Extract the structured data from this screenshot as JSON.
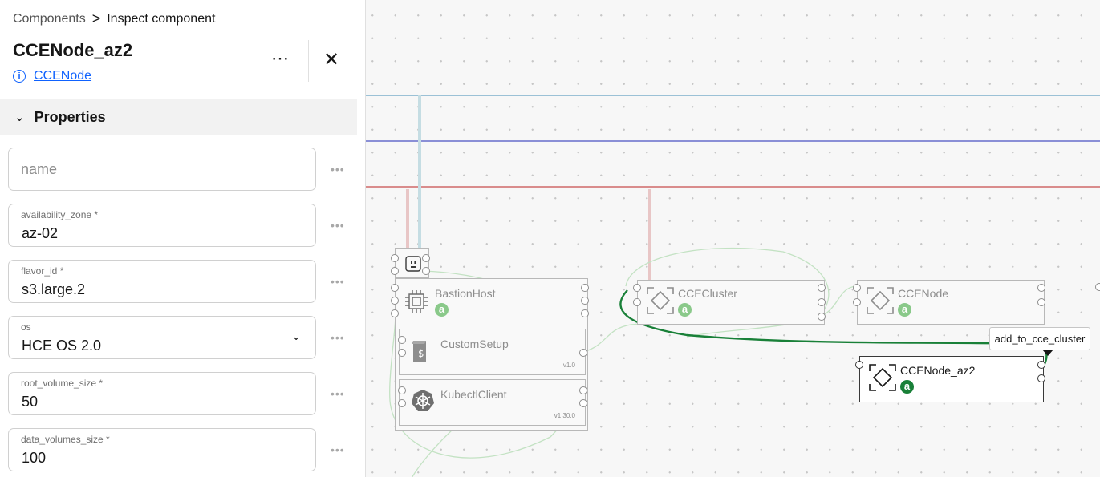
{
  "breadcrumb": {
    "root": "Components",
    "separator": ">",
    "current": "Inspect component"
  },
  "component": {
    "name": "CCENode_az2",
    "type_link": "CCENode"
  },
  "icons": {
    "info": "info-icon",
    "more": "overflow-menu-icon",
    "close": "close-icon",
    "chevron": "chevron-down-icon"
  },
  "properties": {
    "section_label": "Properties",
    "name": {
      "placeholder": "name"
    },
    "availability_zone": {
      "label": "availability_zone *",
      "value": "az-02"
    },
    "flavor_id": {
      "label": "flavor_id *",
      "value": "s3.large.2"
    },
    "os": {
      "label": "os",
      "value": "HCE OS 2.0"
    },
    "root_volume_size": {
      "label": "root_volume_size *",
      "value": "50"
    },
    "data_volumes_size": {
      "label": "data_volumes_size *",
      "value": "100"
    }
  },
  "canvas": {
    "nodes": {
      "bastion": {
        "label": "BastionHost",
        "badge": "a"
      },
      "customsetup": {
        "label": "CustomSetup",
        "version": "v1.0"
      },
      "kubectl": {
        "label": "KubectlClient",
        "version": "v1.30.0"
      },
      "ccecluster": {
        "label": "CCECluster",
        "badge": "a"
      },
      "ccenode": {
        "label": "CCENode",
        "badge": "a"
      },
      "ccenode_az2": {
        "label": "CCENode_az2",
        "badge": "a"
      }
    },
    "tooltip": "add_to_cce_cluster",
    "colors": {
      "line_blue": "#9bc1d6",
      "line_purple": "#8a8fd6",
      "line_red": "#d98c8c",
      "wire_active": "#198038",
      "wire_inactive": "#b5dcb5"
    }
  }
}
